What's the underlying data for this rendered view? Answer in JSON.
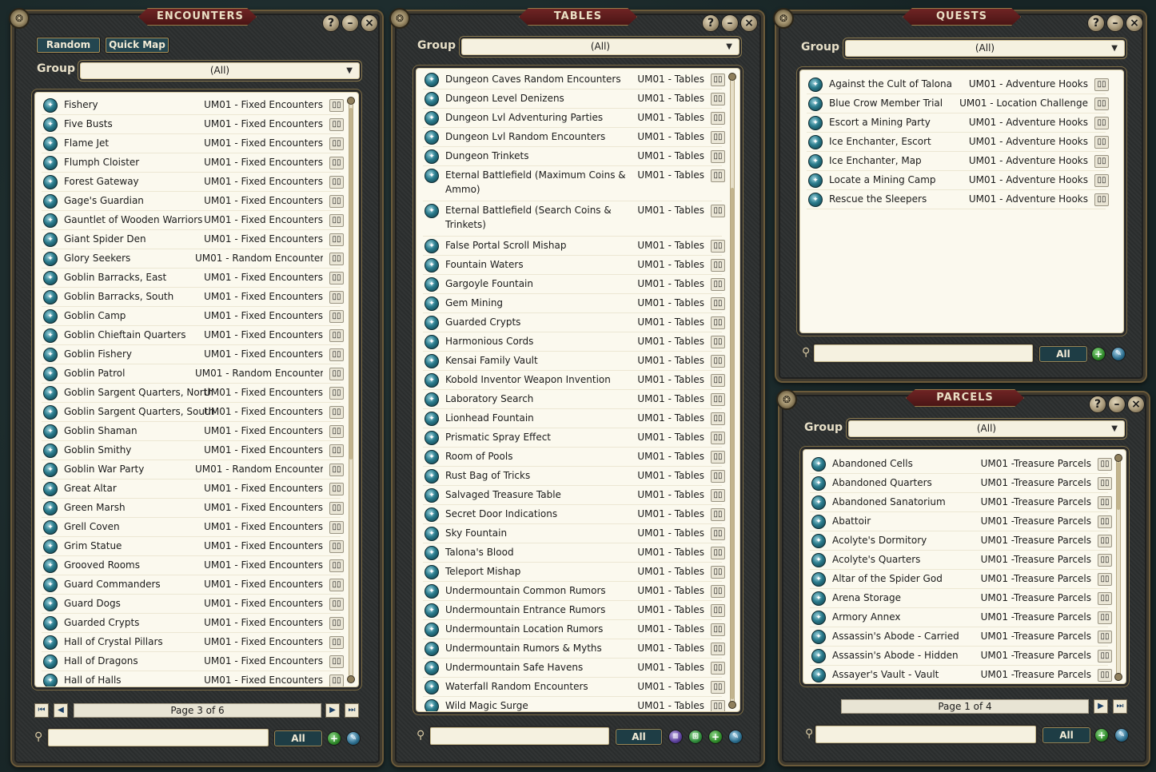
{
  "encounters": {
    "title": "ENCOUNTERS",
    "tab_random": "Random",
    "tab_quickmap": "Quick Map",
    "group_label": "Group",
    "group_value": "(All)",
    "page_label": "Page 3 of 6",
    "filter_all": "All",
    "items": [
      {
        "name": "Fishery",
        "cat": "UM01 - Fixed Encounters"
      },
      {
        "name": "Five Busts",
        "cat": "UM01 - Fixed Encounters"
      },
      {
        "name": "Flame Jet",
        "cat": "UM01 - Fixed Encounters"
      },
      {
        "name": "Flumph Cloister",
        "cat": "UM01 - Fixed Encounters"
      },
      {
        "name": "Forest Gateway",
        "cat": "UM01 - Fixed Encounters"
      },
      {
        "name": "Gage's Guardian",
        "cat": "UM01 - Fixed Encounters"
      },
      {
        "name": "Gauntlet of Wooden Warriors",
        "cat": "UM01 - Fixed Encounters"
      },
      {
        "name": "Giant Spider Den",
        "cat": "UM01 - Fixed Encounters"
      },
      {
        "name": "Glory Seekers",
        "cat": "UM01 - Random Encounter"
      },
      {
        "name": "Goblin Barracks, East",
        "cat": "UM01 - Fixed Encounters"
      },
      {
        "name": "Goblin Barracks, South",
        "cat": "UM01 - Fixed Encounters"
      },
      {
        "name": "Goblin Camp",
        "cat": "UM01 - Fixed Encounters"
      },
      {
        "name": "Goblin Chieftain Quarters",
        "cat": "UM01 - Fixed Encounters"
      },
      {
        "name": "Goblin Fishery",
        "cat": "UM01 - Fixed Encounters"
      },
      {
        "name": "Goblin Patrol",
        "cat": "UM01 - Random Encounter"
      },
      {
        "name": "Goblin Sargent Quarters, North",
        "cat": "UM01 - Fixed Encounters"
      },
      {
        "name": "Goblin Sargent Quarters, South",
        "cat": "UM01 - Fixed Encounters"
      },
      {
        "name": "Goblin Shaman",
        "cat": "UM01 - Fixed Encounters"
      },
      {
        "name": "Goblin Smithy",
        "cat": "UM01 - Fixed Encounters"
      },
      {
        "name": "Goblin War Party",
        "cat": "UM01 - Random Encounter"
      },
      {
        "name": "Great Altar",
        "cat": "UM01 - Fixed Encounters"
      },
      {
        "name": "Green Marsh",
        "cat": "UM01 - Fixed Encounters"
      },
      {
        "name": "Grell Coven",
        "cat": "UM01 - Fixed Encounters"
      },
      {
        "name": "Grim Statue",
        "cat": "UM01 - Fixed Encounters"
      },
      {
        "name": "Grooved Rooms",
        "cat": "UM01 - Fixed Encounters"
      },
      {
        "name": "Guard Commanders",
        "cat": "UM01 - Fixed Encounters"
      },
      {
        "name": "Guard Dogs",
        "cat": "UM01 - Fixed Encounters"
      },
      {
        "name": "Guarded Crypts",
        "cat": "UM01 - Fixed Encounters"
      },
      {
        "name": "Hall of Crystal Pillars",
        "cat": "UM01 - Fixed Encounters"
      },
      {
        "name": "Hall of Dragons",
        "cat": "UM01 - Fixed Encounters"
      },
      {
        "name": "Hall of Halls",
        "cat": "UM01 - Fixed Encounters"
      }
    ]
  },
  "tables": {
    "title": "TABLES",
    "group_label": "Group",
    "group_value": "(All)",
    "filter_all": "All",
    "items": [
      {
        "name": "Dungeon Caves Random Encounters",
        "cat": "UM01 - Tables"
      },
      {
        "name": "Dungeon Level Denizens",
        "cat": "UM01 - Tables"
      },
      {
        "name": "Dungeon Lvl Adventuring Parties",
        "cat": "UM01 - Tables"
      },
      {
        "name": "Dungeon Lvl Random Encounters",
        "cat": "UM01 - Tables"
      },
      {
        "name": "Dungeon Trinkets",
        "cat": "UM01 - Tables"
      },
      {
        "name": "Eternal Battlefield (Maximum Coins &",
        "name2": "Ammo)",
        "cat": "UM01 - Tables"
      },
      {
        "name": "Eternal Battlefield (Search Coins &",
        "name2": "Trinkets)",
        "cat": "UM01 - Tables"
      },
      {
        "name": "False Portal Scroll Mishap",
        "cat": "UM01 - Tables"
      },
      {
        "name": "Fountain Waters",
        "cat": "UM01 - Tables"
      },
      {
        "name": "Gargoyle Fountain",
        "cat": "UM01 - Tables"
      },
      {
        "name": "Gem Mining",
        "cat": "UM01 - Tables"
      },
      {
        "name": "Guarded Crypts",
        "cat": "UM01 - Tables"
      },
      {
        "name": "Harmonious Cords",
        "cat": "UM01 - Tables"
      },
      {
        "name": "Kensai Family Vault",
        "cat": "UM01 - Tables"
      },
      {
        "name": "Kobold Inventor Weapon Invention",
        "cat": "UM01 - Tables"
      },
      {
        "name": "Laboratory Search",
        "cat": "UM01 - Tables"
      },
      {
        "name": "Lionhead Fountain",
        "cat": "UM01 - Tables"
      },
      {
        "name": "Prismatic Spray Effect",
        "cat": "UM01 - Tables"
      },
      {
        "name": "Room of Pools",
        "cat": "UM01 - Tables"
      },
      {
        "name": "Rust Bag of Tricks",
        "cat": "UM01 - Tables"
      },
      {
        "name": "Salvaged Treasure Table",
        "cat": "UM01 - Tables"
      },
      {
        "name": "Secret Door Indications",
        "cat": "UM01 - Tables"
      },
      {
        "name": "Sky Fountain",
        "cat": "UM01 - Tables"
      },
      {
        "name": "Talona's Blood",
        "cat": "UM01 - Tables"
      },
      {
        "name": "Teleport Mishap",
        "cat": "UM01 - Tables"
      },
      {
        "name": "Undermountain Common Rumors",
        "cat": "UM01 - Tables"
      },
      {
        "name": "Undermountain Entrance Rumors",
        "cat": "UM01 - Tables"
      },
      {
        "name": "Undermountain Location Rumors",
        "cat": "UM01 - Tables"
      },
      {
        "name": "Undermountain Rumors & Myths",
        "cat": "UM01 - Tables"
      },
      {
        "name": "Undermountain Safe Havens",
        "cat": "UM01 - Tables"
      },
      {
        "name": "Waterfall Random Encounters",
        "cat": "UM01 - Tables"
      },
      {
        "name": "Wild Magic Surge",
        "cat": "UM01 - Tables"
      }
    ]
  },
  "quests": {
    "title": "QUESTS",
    "group_label": "Group",
    "group_value": "(All)",
    "filter_all": "All",
    "items": [
      {
        "name": "Against the Cult of Talona",
        "cat": "UM01 - Adventure Hooks"
      },
      {
        "name": "Blue Crow Member Trial",
        "cat": "UM01 - Location Challenge"
      },
      {
        "name": "Escort a Mining Party",
        "cat": "UM01 - Adventure Hooks"
      },
      {
        "name": "Ice Enchanter, Escort",
        "cat": "UM01 - Adventure Hooks"
      },
      {
        "name": "Ice Enchanter, Map",
        "cat": "UM01 - Adventure Hooks"
      },
      {
        "name": "Locate a Mining Camp",
        "cat": "UM01 - Adventure Hooks"
      },
      {
        "name": "Rescue the Sleepers",
        "cat": "UM01 - Adventure Hooks"
      }
    ]
  },
  "parcels": {
    "title": "PARCELS",
    "group_label": "Group",
    "group_value": "(All)",
    "page_label": "Page 1 of 4",
    "filter_all": "All",
    "items": [
      {
        "name": "Abandoned Cells",
        "cat": "UM01 -Treasure Parcels"
      },
      {
        "name": "Abandoned Quarters",
        "cat": "UM01 -Treasure Parcels"
      },
      {
        "name": "Abandoned Sanatorium",
        "cat": "UM01 -Treasure Parcels"
      },
      {
        "name": "Abattoir",
        "cat": "UM01 -Treasure Parcels"
      },
      {
        "name": "Acolyte's Dormitory",
        "cat": "UM01 -Treasure Parcels"
      },
      {
        "name": "Acolyte's Quarters",
        "cat": "UM01 -Treasure Parcels"
      },
      {
        "name": "Altar of the Spider God",
        "cat": "UM01 -Treasure Parcels"
      },
      {
        "name": "Arena Storage",
        "cat": "UM01 -Treasure Parcels"
      },
      {
        "name": "Armory Annex",
        "cat": "UM01 -Treasure Parcels"
      },
      {
        "name": "Assassin's Abode - Carried",
        "cat": "UM01 -Treasure Parcels"
      },
      {
        "name": "Assassin's Abode - Hidden",
        "cat": "UM01 -Treasure Parcels"
      },
      {
        "name": "Assayer's Vault - Vault",
        "cat": "UM01 -Treasure Parcels"
      }
    ]
  },
  "icons": {
    "help": "?",
    "minimize": "–",
    "close": "×",
    "corner": "❂",
    "search": "⚲",
    "dropdown": "▼",
    "book": "▯▯",
    "first": "⏮",
    "prev": "◀",
    "next": "▶",
    "last": "⏭",
    "plus": "+",
    "edit": "✎",
    "list": "≡",
    "grid": "⊞",
    "row": "✦"
  }
}
